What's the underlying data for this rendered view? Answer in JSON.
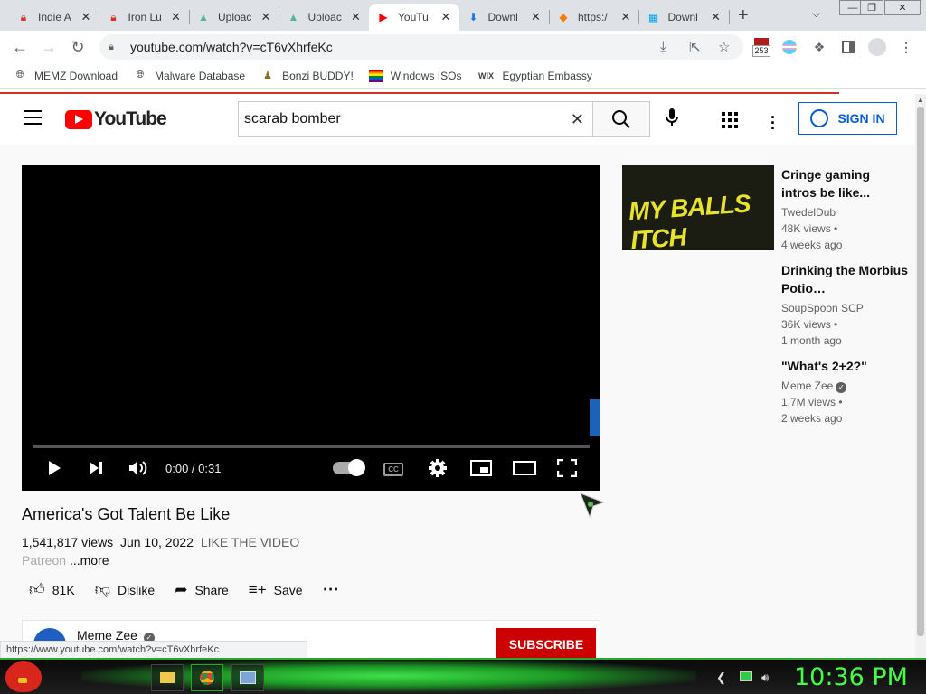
{
  "browser": {
    "tabs": [
      {
        "title": "Indie A",
        "favicon": "lock-red-icon",
        "color": "#d93025"
      },
      {
        "title": "Iron Lu",
        "favicon": "lock-red-icon",
        "color": "#d93025"
      },
      {
        "title": "Uploac",
        "favicon": "upload-icon",
        "color": "#4fb892"
      },
      {
        "title": "Uploac",
        "favicon": "upload-icon",
        "color": "#4fb892"
      },
      {
        "title": "YouTu",
        "favicon": "youtube-icon",
        "color": "#ff0000"
      },
      {
        "title": "Downl",
        "favicon": "download-icon",
        "color": "#1a73e8"
      },
      {
        "title": "https:/",
        "favicon": "diamond-icon",
        "color": "#f57c00"
      },
      {
        "title": "Downl",
        "favicon": "windows-icon",
        "color": "#00a4ef"
      }
    ],
    "active_tab": 4,
    "url": "youtube.com/watch?v=cT6vXhrfeKc",
    "badge_count": "253",
    "bookmarks": [
      "MEMZ Download",
      "Malware Database",
      "Bonzi BUDDY!",
      "Windows ISOs",
      "Egyptian Embassy"
    ],
    "status_url": "https://www.youtube.com/watch?v=cT6vXhrfeKc"
  },
  "youtube": {
    "logo_text": "YouTube",
    "search_value": "scarab bomber",
    "sign_in": "SIGN IN",
    "player": {
      "time": "0:00 / 0:31",
      "cc_label": "CC"
    },
    "video": {
      "title": "America's Got Talent Be Like",
      "views": "1,541,817 views",
      "date": "Jun 10, 2022",
      "tag": "LIKE THE VIDEO",
      "desc_start": "Patreon",
      "more": "...more",
      "likes": "81K",
      "dislike": "Dislike",
      "share": "Share",
      "save": "Save",
      "channel": "Meme Zee",
      "subscribe": "SUBSCRIBE"
    },
    "related": [
      {
        "title": "Cringe gaming intros be like...",
        "channel": "TwedelDub",
        "views": "48K views •",
        "age": "4 weeks ago",
        "verified": false,
        "thumb_text": "MY BALLS ITCH"
      },
      {
        "title": "Drinking the Morbius Potio…",
        "channel": "SoupSpoon SCP",
        "views": "36K views •",
        "age": "1 month ago",
        "verified": false
      },
      {
        "title": "\"What's 2+2?\"",
        "channel": "Meme Zee",
        "views": "1.7M views •",
        "age": "2 weeks ago",
        "verified": true
      }
    ]
  },
  "taskbar": {
    "clock": "10:36 PM",
    "accent": "#44ff44"
  }
}
